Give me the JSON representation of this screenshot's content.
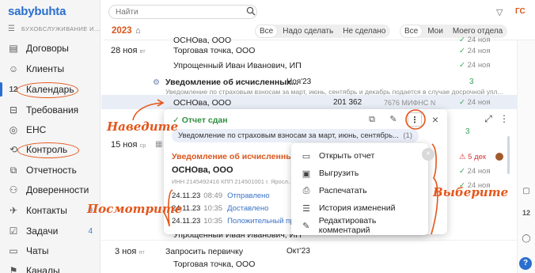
{
  "app": {
    "logo": "sabybuhta",
    "org_name": "БУХОБСЛУЖИВАНИЕ И..."
  },
  "sidebar": {
    "items": [
      {
        "label": "Договоры",
        "icon": "contract-icon"
      },
      {
        "label": "Клиенты",
        "icon": "clients-icon"
      },
      {
        "label": "Календарь",
        "icon": "calendar-icon",
        "icon_text": "12"
      },
      {
        "label": "Требования",
        "icon": "requirements-icon"
      },
      {
        "label": "ЕНС",
        "icon": "ens-icon"
      },
      {
        "label": "Контроль",
        "icon": "control-icon"
      },
      {
        "label": "Отчетность",
        "icon": "reports-icon"
      },
      {
        "label": "Доверенности",
        "icon": "power-of-attorney-icon"
      },
      {
        "label": "Контакты",
        "icon": "contacts-icon",
        "badge": "9"
      },
      {
        "label": "Задачи",
        "icon": "tasks-icon",
        "badge": "4"
      },
      {
        "label": "Чаты",
        "icon": "chats-icon"
      },
      {
        "label": "Каналы",
        "icon": "channels-icon"
      }
    ]
  },
  "search": {
    "placeholder": "Найти"
  },
  "toolbar": {
    "year": "2023",
    "filter1": [
      "Все",
      "Надо сделать",
      "Не сделано"
    ],
    "filter2": [
      "Все",
      "Мои",
      "Моего отдела"
    ],
    "user_initials": "ГС"
  },
  "rows": {
    "r1_org": "ОСНОва, ООО",
    "r1_check": "24 ноя",
    "r2_date": "28 ноя",
    "r2_dow": "вт",
    "r2_org": "Торговая точка, ООО",
    "r2_check": "24 ноя",
    "r3_org": "Упрощенный Иван Иванович, ИП",
    "r3_check": "24 ноя",
    "group_title": "Уведомление об исчисленных...",
    "group_period": "Ноя'23",
    "group_count": "3",
    "group_desc": "Уведомление по страховым взносам за март, июнь, сентябрь и декабрь подается в случае досрочной упл...",
    "sel_org": "ОСНОва, ООО",
    "sel_sum": "201 362",
    "sel_ifns": "7676 МИФНС №...",
    "r5_check": "24 ноя",
    "d15_date": "15 ноя",
    "d15_dow": "ср",
    "right_count": "3",
    "right_red": "5 дек",
    "right_check1": "24 ноя",
    "right_check2": "24 ноя",
    "d3_date": "3 ноя",
    "d3_dow": "пт",
    "d3_title": "Запросить первичку",
    "d3_period": "Окт'23",
    "d3_org": "Торговая точка, ООО",
    "d3_after": "Упрощенный Иван Иванович, ИП"
  },
  "card": {
    "status": "Отчет сдан",
    "desc": "Уведомление по страховым взносам за март, июнь, сентябрь...",
    "desc_count": "(1)",
    "title": "Уведомление об исчисленных",
    "org": "ОСНОва, ООО",
    "inn": "ИНН 2145492416 КПП 214501001 г. Яросл...",
    "events": [
      {
        "date": "24.11.23",
        "time": "08:49",
        "status": "Отправлено"
      },
      {
        "date": "24.11.23",
        "time": "10:35",
        "status": "Доставлено"
      },
      {
        "date": "24.11.23",
        "time": "10:35",
        "status": "Положительный прот..."
      }
    ]
  },
  "menu": {
    "items": [
      {
        "label": "Открыть отчет",
        "icon": "open-report-icon"
      },
      {
        "label": "Выгрузить",
        "icon": "upload-icon"
      },
      {
        "label": "Распечатать",
        "icon": "print-icon"
      },
      {
        "label": "История изменений",
        "icon": "history-icon"
      },
      {
        "label": "Редактировать комментарий",
        "icon": "edit-comment-icon"
      }
    ]
  },
  "annotations": {
    "hover": "Наведите",
    "view": "Посмотрите",
    "choose": "Выберите"
  },
  "colors": {
    "accent": "#2a6fcf",
    "annotation": "#e4561b",
    "success": "#2f8f3f",
    "danger": "#d33333"
  }
}
